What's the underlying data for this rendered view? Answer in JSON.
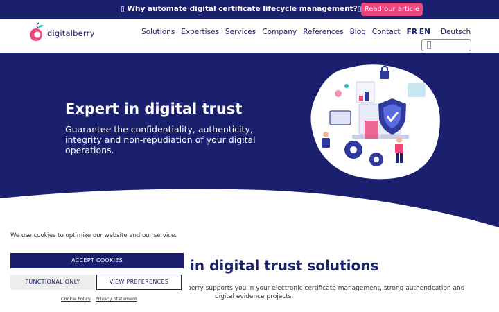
{
  "colors": {
    "navy": "#1a1f6e",
    "pink": "#f0467e",
    "white": "#ffffff"
  },
  "topbar": {
    "message": "Why automate digital certificate lifecycle management?",
    "cta": "Read our article"
  },
  "header": {
    "logo_text": "digitalberry",
    "nav": [
      "Solutions",
      "Expertises",
      "Services",
      "Company",
      "References",
      "Blog",
      "Contact"
    ],
    "lang_fr": "FR",
    "lang_en": "EN",
    "lang_de": "Deutsch",
    "search_icon": "search-icon"
  },
  "hero": {
    "title": "Expert in digital trust",
    "subtitle": "Guarantee the confidentiality, authenticity, integrity and non-repudiation of your digital operations."
  },
  "solutions": {
    "title": "in digital trust solutions",
    "text_line1": "berry supports you in your electronic certificate management, strong authentication and",
    "text_line2": "digital evidence projects."
  },
  "cookie": {
    "text": "We use cookies to optimize our website and our service.",
    "accept": "ACCEPT COOKIES",
    "functional": "FUNCTIONAL ONLY",
    "preferences": "VIEW PREFERENCES",
    "cookie_policy": "Cookie Policy",
    "privacy": "Privacy Statement"
  }
}
